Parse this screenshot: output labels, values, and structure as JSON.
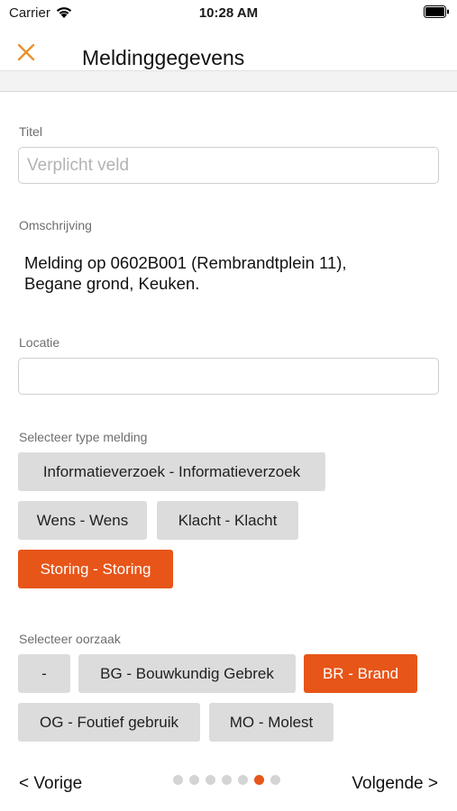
{
  "status_bar": {
    "carrier": "Carrier",
    "time": "10:28 AM"
  },
  "nav": {
    "title": "Meldinggegevens",
    "close_icon": "close-icon"
  },
  "form": {
    "title_label": "Titel",
    "title_placeholder": "Verplicht veld",
    "title_value": "",
    "description_label": "Omschrijving",
    "description_text": "Melding op 0602B001 (Rembrandtplein 11),\nBegane grond, Keuken.",
    "location_label": "Locatie",
    "location_value": "",
    "type_label": "Selecteer type melding",
    "types": [
      {
        "label": "Informatieverzoek - Informatieverzoek",
        "selected": false
      },
      {
        "label": "Wens - Wens",
        "selected": false
      },
      {
        "label": "Klacht - Klacht",
        "selected": false
      },
      {
        "label": "Storing - Storing",
        "selected": true
      }
    ],
    "cause_label": "Selecteer oorzaak",
    "causes": [
      {
        "label": "-",
        "selected": false
      },
      {
        "label": "BG - Bouwkundig Gebrek",
        "selected": false
      },
      {
        "label": "BR - Brand",
        "selected": true
      },
      {
        "label": "OG - Foutief gebruik",
        "selected": false
      },
      {
        "label": "MO - Molest",
        "selected": false
      }
    ]
  },
  "footer": {
    "prev_label": "< Vorige",
    "next_label": "Volgende >",
    "page_count": 7,
    "current_page": 6
  },
  "colors": {
    "accent": "#e75519",
    "chip_background": "#dcdcdc",
    "label_text": "#6e6e6e"
  }
}
